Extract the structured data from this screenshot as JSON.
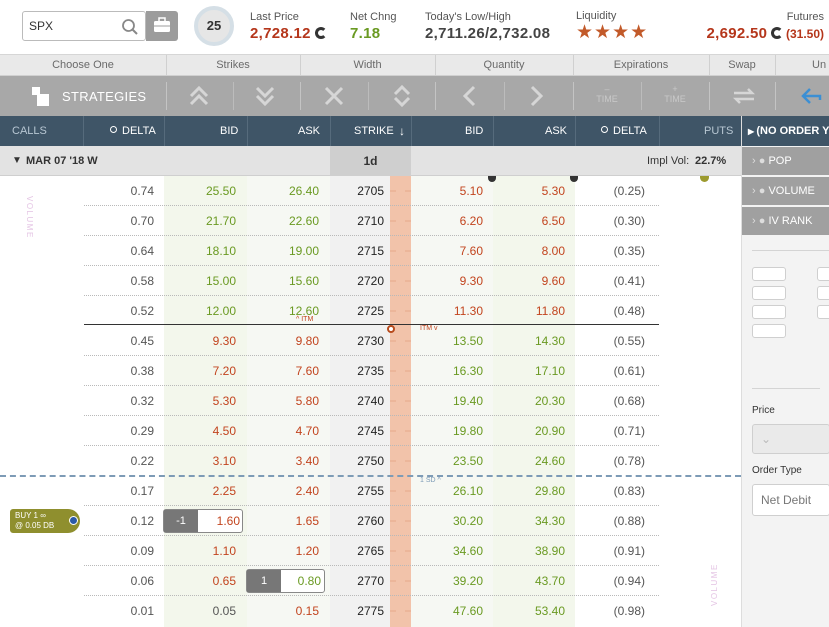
{
  "quote": {
    "symbol_value": "SPX",
    "ivr": "25",
    "last_price_label": "Last Price",
    "last_price": "2,728.12",
    "net_change_label": "Net Chng",
    "net_change": "7.18",
    "low_high_label": "Today's Low/High",
    "low_high": "2,711.26/2,732.08",
    "liquidity_label": "Liquidity",
    "liquidity_stars": "★★★★",
    "futures_label": "Futures",
    "futures_price": "2,692.50",
    "futures_change": "(31.50)"
  },
  "toolbar_headers": [
    "Choose One",
    "Strikes",
    "Width",
    "Quantity",
    "Expirations",
    "Swap",
    "Un"
  ],
  "toolbar": {
    "strategies_label": "STRATEGIES",
    "time_minus": "TIME",
    "time_plus": "TIME"
  },
  "columns": {
    "calls": "CALLS",
    "call_delta": "DELTA",
    "call_bid": "BID",
    "call_ask": "ASK",
    "strike": "STRIKE",
    "put_bid": "BID",
    "put_ask": "ASK",
    "put_delta": "DELTA",
    "puts": "PUTS"
  },
  "expiration": {
    "date": "MAR 07 '18 W",
    "dte": "1d",
    "impl_vol_label": "Impl Vol:",
    "impl_vol": "22.7%"
  },
  "volume_label": "VOLUME",
  "itm_label_call": "^ ITM",
  "itm_label_put": "ITM v",
  "sd_label": "1 SD ^",
  "rows": [
    {
      "cdelta": "0.74",
      "cbid": "25.50",
      "cask": "26.40",
      "strike": "2705",
      "pbid": "5.10",
      "pask": "5.30",
      "pdelta": "(0.25)"
    },
    {
      "cdelta": "0.70",
      "cbid": "21.70",
      "cask": "22.60",
      "strike": "2710",
      "pbid": "6.20",
      "pask": "6.50",
      "pdelta": "(0.30)"
    },
    {
      "cdelta": "0.64",
      "cbid": "18.10",
      "cask": "19.00",
      "strike": "2715",
      "pbid": "7.60",
      "pask": "8.00",
      "pdelta": "(0.35)"
    },
    {
      "cdelta": "0.58",
      "cbid": "15.00",
      "cask": "15.60",
      "strike": "2720",
      "pbid": "9.30",
      "pask": "9.60",
      "pdelta": "(0.41)"
    },
    {
      "cdelta": "0.52",
      "cbid": "12.00",
      "cask": "12.60",
      "strike": "2725",
      "pbid": "11.30",
      "pask": "11.80",
      "pdelta": "(0.48)"
    },
    {
      "cdelta": "0.45",
      "cbid": "9.30",
      "cask": "9.80",
      "strike": "2730",
      "pbid": "13.50",
      "pask": "14.30",
      "pdelta": "(0.55)"
    },
    {
      "cdelta": "0.38",
      "cbid": "7.20",
      "cask": "7.60",
      "strike": "2735",
      "pbid": "16.30",
      "pask": "17.10",
      "pdelta": "(0.61)"
    },
    {
      "cdelta": "0.32",
      "cbid": "5.30",
      "cask": "5.80",
      "strike": "2740",
      "pbid": "19.40",
      "pask": "20.30",
      "pdelta": "(0.68)"
    },
    {
      "cdelta": "0.29",
      "cbid": "4.50",
      "cask": "4.70",
      "strike": "2745",
      "pbid": "19.80",
      "pask": "20.90",
      "pdelta": "(0.71)"
    },
    {
      "cdelta": "0.22",
      "cbid": "3.10",
      "cask": "3.40",
      "strike": "2750",
      "pbid": "23.50",
      "pask": "24.60",
      "pdelta": "(0.78)"
    },
    {
      "cdelta": "0.17",
      "cbid": "2.25",
      "cask": "2.40",
      "strike": "2755",
      "pbid": "26.10",
      "pask": "29.80",
      "pdelta": "(0.83)"
    },
    {
      "cdelta": "0.12",
      "cbid": "1.60",
      "cask": "1.65",
      "strike": "2760",
      "pbid": "30.20",
      "pask": "34.30",
      "pdelta": "(0.88)"
    },
    {
      "cdelta": "0.09",
      "cbid": "1.10",
      "cask": "1.20",
      "strike": "2765",
      "pbid": "34.60",
      "pask": "38.90",
      "pdelta": "(0.91)"
    },
    {
      "cdelta": "0.06",
      "cbid": "0.65",
      "cask": "0.80",
      "strike": "2770",
      "pbid": "39.20",
      "pask": "43.70",
      "pdelta": "(0.94)"
    },
    {
      "cdelta": "0.01",
      "cbid": "0.05",
      "cask": "0.15",
      "strike": "2775",
      "pbid": "47.60",
      "pask": "53.40",
      "pdelta": "(0.98)"
    }
  ],
  "order_chips": {
    "sell_qty": "-1",
    "sell_price": "1.60",
    "buy_qty": "1",
    "buy_price": "0.80"
  },
  "position_badge": {
    "line1": "BUY 1 ∞",
    "line2": "@ 0.05 DB"
  },
  "right_panel": {
    "no_order": "(NO ORDER YET)",
    "pop": "POP",
    "volume": "VOLUME",
    "ivrank": "IV RANK",
    "price_label": "Price",
    "order_type_label": "Order Type",
    "order_type_value": "Net Debit"
  },
  "colors": {
    "header_dark": "#3f5567",
    "toolbar_gray": "#a8a8a8",
    "strike_band": "#f2c3aa",
    "bid_green": "#6a9a22",
    "bid_red": "#c2441e",
    "badge_olive": "#8f8f2e",
    "last_price_red": "#b5361b"
  }
}
